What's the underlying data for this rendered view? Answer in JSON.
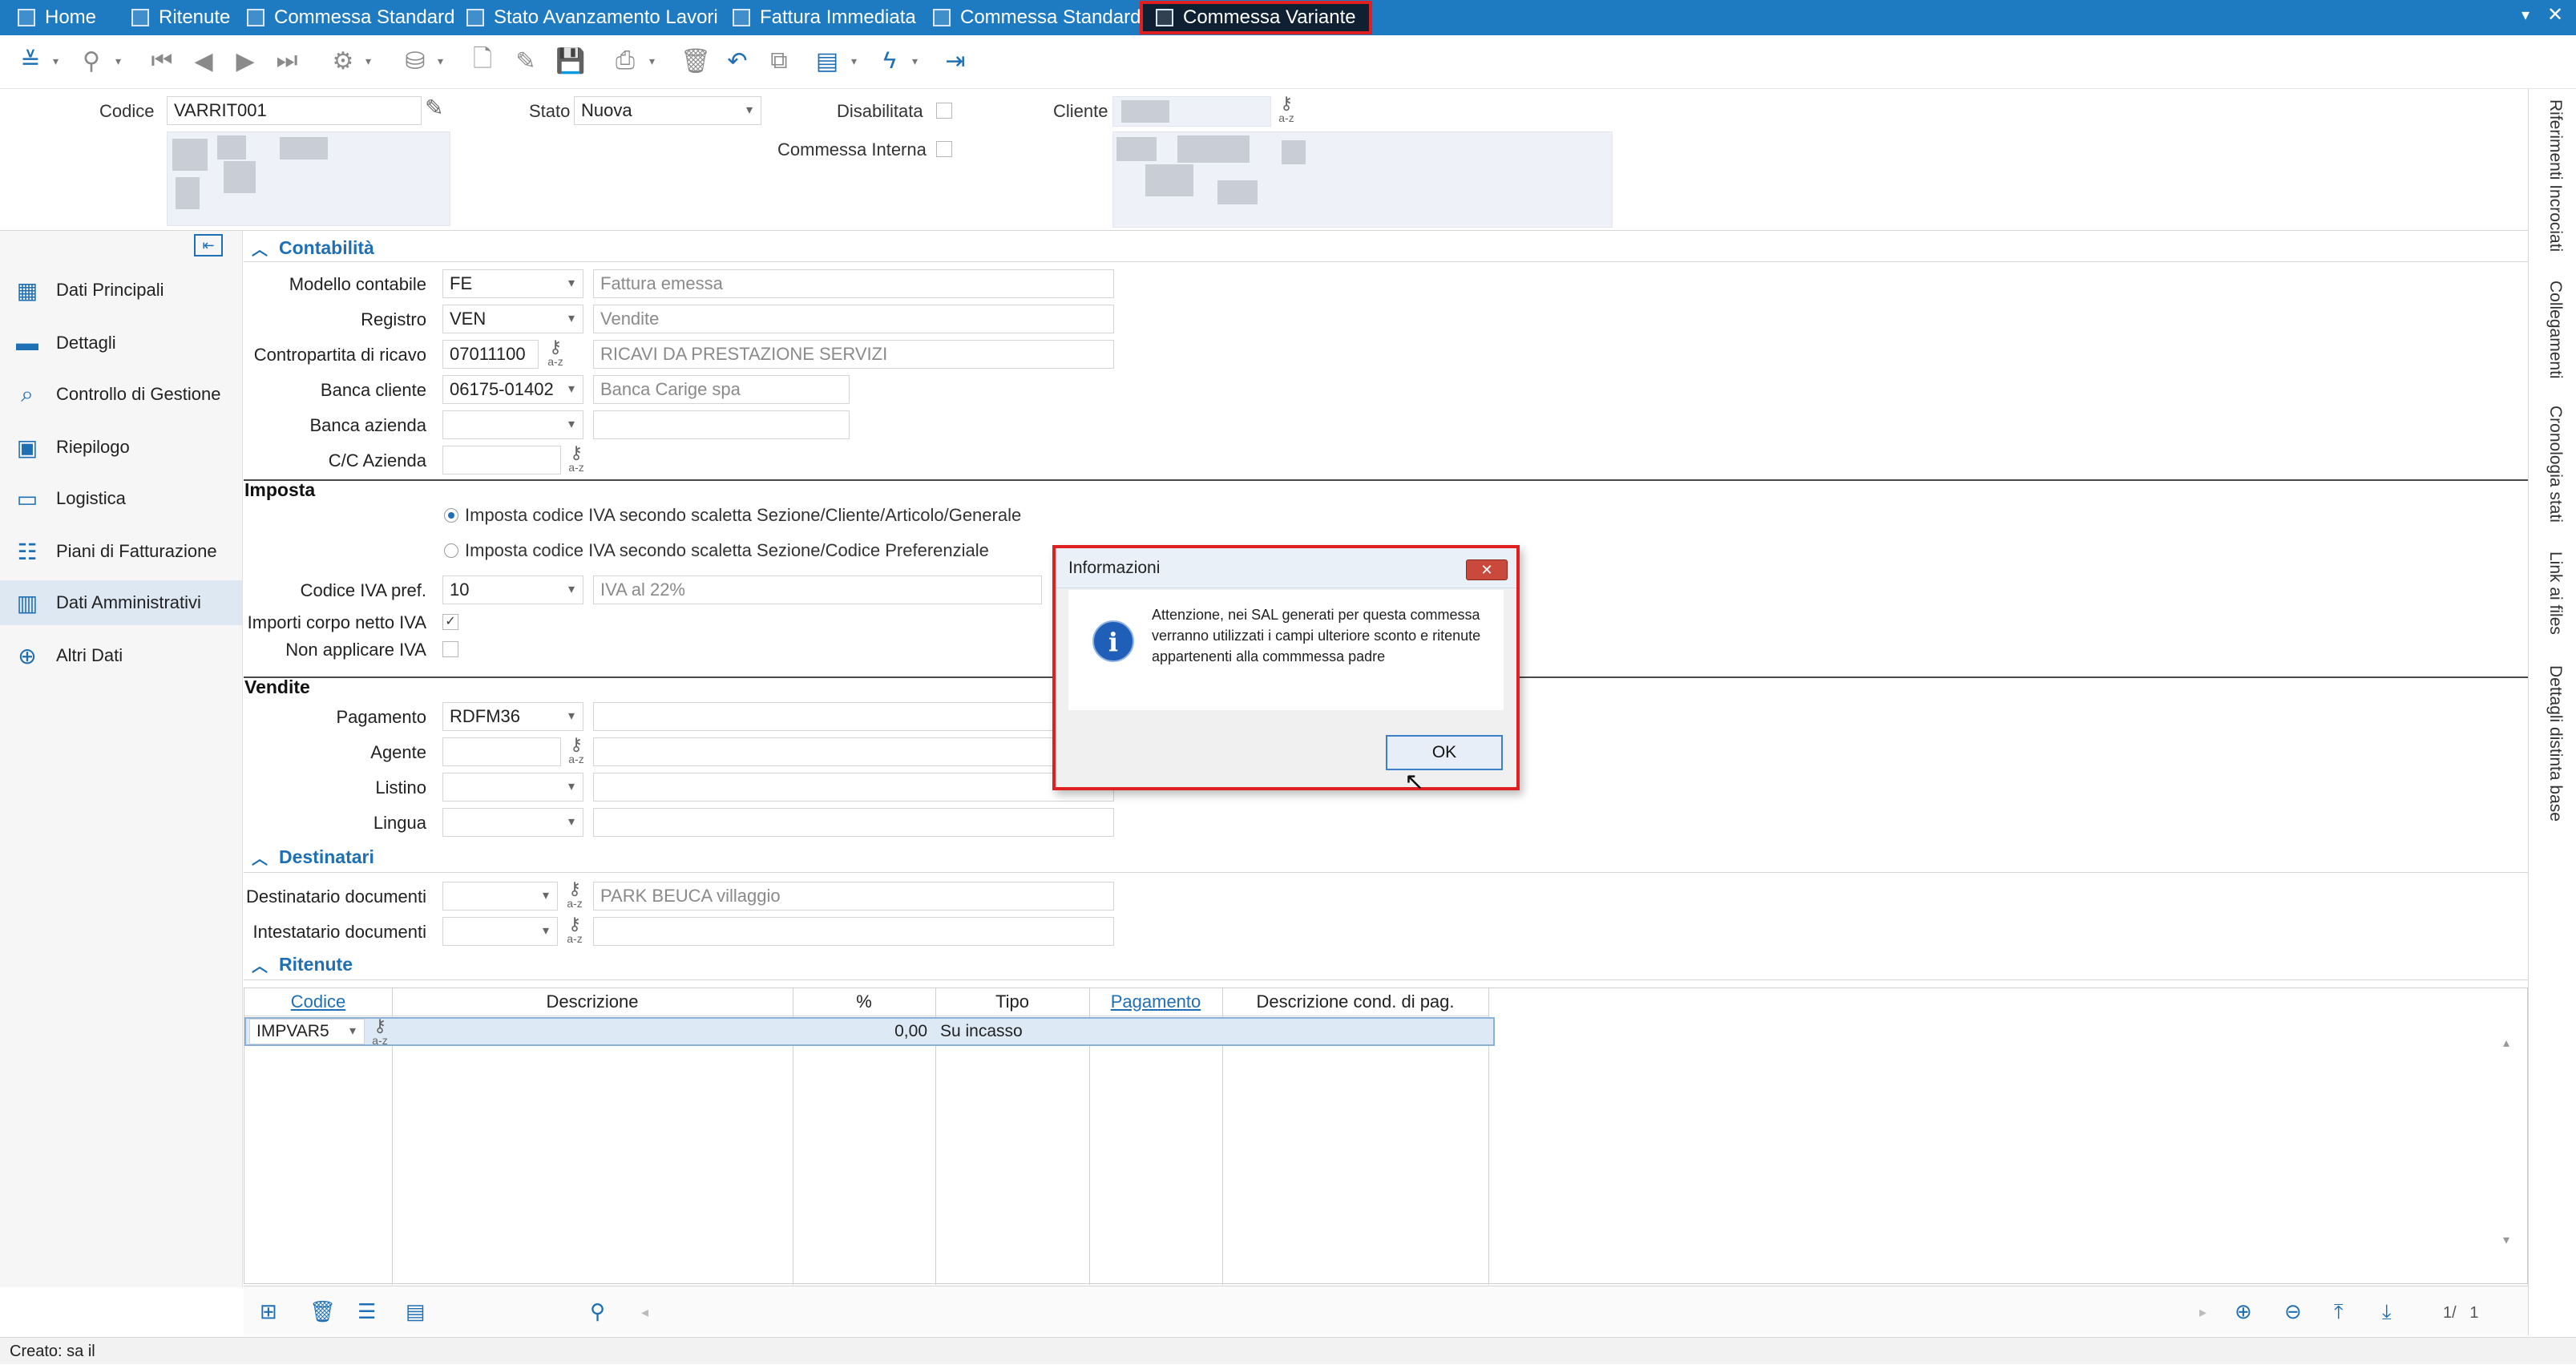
{
  "tabs": [
    {
      "label": "Home"
    },
    {
      "label": "Ritenute"
    },
    {
      "label": "Commessa Standard"
    },
    {
      "label": "Stato Avanzamento Lavori"
    },
    {
      "label": "Fattura Immediata"
    },
    {
      "label": "Commessa Standard"
    },
    {
      "label": "Commessa Variante"
    }
  ],
  "window_controls": {
    "menu": "▾",
    "close": "✕"
  },
  "header": {
    "codice_label": "Codice",
    "codice_value": "VARRIT001",
    "stato_label": "Stato",
    "stato_value": "Nuova",
    "disabilitata_label": "Disabilitata",
    "commessa_interna_label": "Commessa Interna",
    "cliente_label": "Cliente"
  },
  "nav": {
    "items": [
      {
        "label": "Dati Principali",
        "icon": "grid-icon"
      },
      {
        "label": "Dettagli",
        "icon": "folder-icon"
      },
      {
        "label": "Controllo di Gestione",
        "icon": "report-search-icon"
      },
      {
        "label": "Riepilogo",
        "icon": "summary-icon"
      },
      {
        "label": "Logistica",
        "icon": "window-icon"
      },
      {
        "label": "Piani di Fatturazione",
        "icon": "billing-plan-icon"
      },
      {
        "label": "Dati Amministrativi",
        "icon": "admin-data-icon"
      },
      {
        "label": "Altri Dati",
        "icon": "add-document-icon"
      }
    ],
    "selected": "Dati Amministrativi"
  },
  "contabilita": {
    "title": "Contabilità",
    "modello_contabile_label": "Modello contabile",
    "modello_contabile_value": "FE",
    "modello_contabile_desc": "Fattura emessa",
    "registro_label": "Registro",
    "registro_value": "VEN",
    "registro_desc": "Vendite",
    "contropartita_label": "Contropartita di ricavo",
    "contropartita_value": "07011100",
    "contropartita_desc": "RICAVI DA PRESTAZIONE SERVIZI",
    "banca_cliente_label": "Banca cliente",
    "banca_cliente_value": "06175-01402",
    "banca_cliente_desc": "Banca Carige spa",
    "banca_azienda_label": "Banca azienda",
    "cc_azienda_label": "C/C Azienda"
  },
  "imposta": {
    "title": "Imposta",
    "radio1": "Imposta codice IVA secondo scaletta Sezione/Cliente/Articolo/Generale",
    "radio2": "Imposta codice IVA secondo scaletta Sezione/Codice Preferenziale",
    "codice_iva_label": "Codice IVA pref.",
    "codice_iva_value": "10",
    "codice_iva_desc": "IVA al 22%",
    "importi_label": "Importi corpo netto IVA",
    "non_applicare_label": "Non applicare IVA"
  },
  "vendite": {
    "title": "Vendite",
    "pagamento_label": "Pagamento",
    "pagamento_value": "RDFM36",
    "agente_label": "Agente",
    "listino_label": "Listino",
    "lingua_label": "Lingua"
  },
  "destinatari": {
    "title": "Destinatari",
    "dest_doc_label": "Destinatario documenti",
    "dest_doc_desc": "PARK BEUCA villaggio",
    "intestatario_label": "Intestatario documenti"
  },
  "ritenute": {
    "title": "Ritenute",
    "columns": [
      "Codice",
      "Descrizione",
      "%",
      "Tipo",
      "Pagamento",
      "Descrizione cond. di pag."
    ],
    "rows": [
      {
        "codice": "IMPVAR5",
        "descrizione": "",
        "perc": "0,00",
        "tipo": "Su incasso",
        "pagamento": "",
        "desc_cond": ""
      }
    ]
  },
  "right_tabs": [
    "Riferimenti Incrociati",
    "Collegamenti",
    "Cronologia stati",
    "Link ai files",
    "Dettagli distinta base"
  ],
  "pager": "1/   1",
  "status_bar": "Creato: sa il",
  "dialog": {
    "title": "Informazioni",
    "close": "✕",
    "message": "Attenzione, nei SAL generati per questa commessa verranno utilizzati i campi ulteriore sconto e ritenute appartenenti alla commmessa padre",
    "ok": "OK"
  },
  "colors": {
    "accent": "#1f7bc1",
    "highlight": "#e02020"
  }
}
